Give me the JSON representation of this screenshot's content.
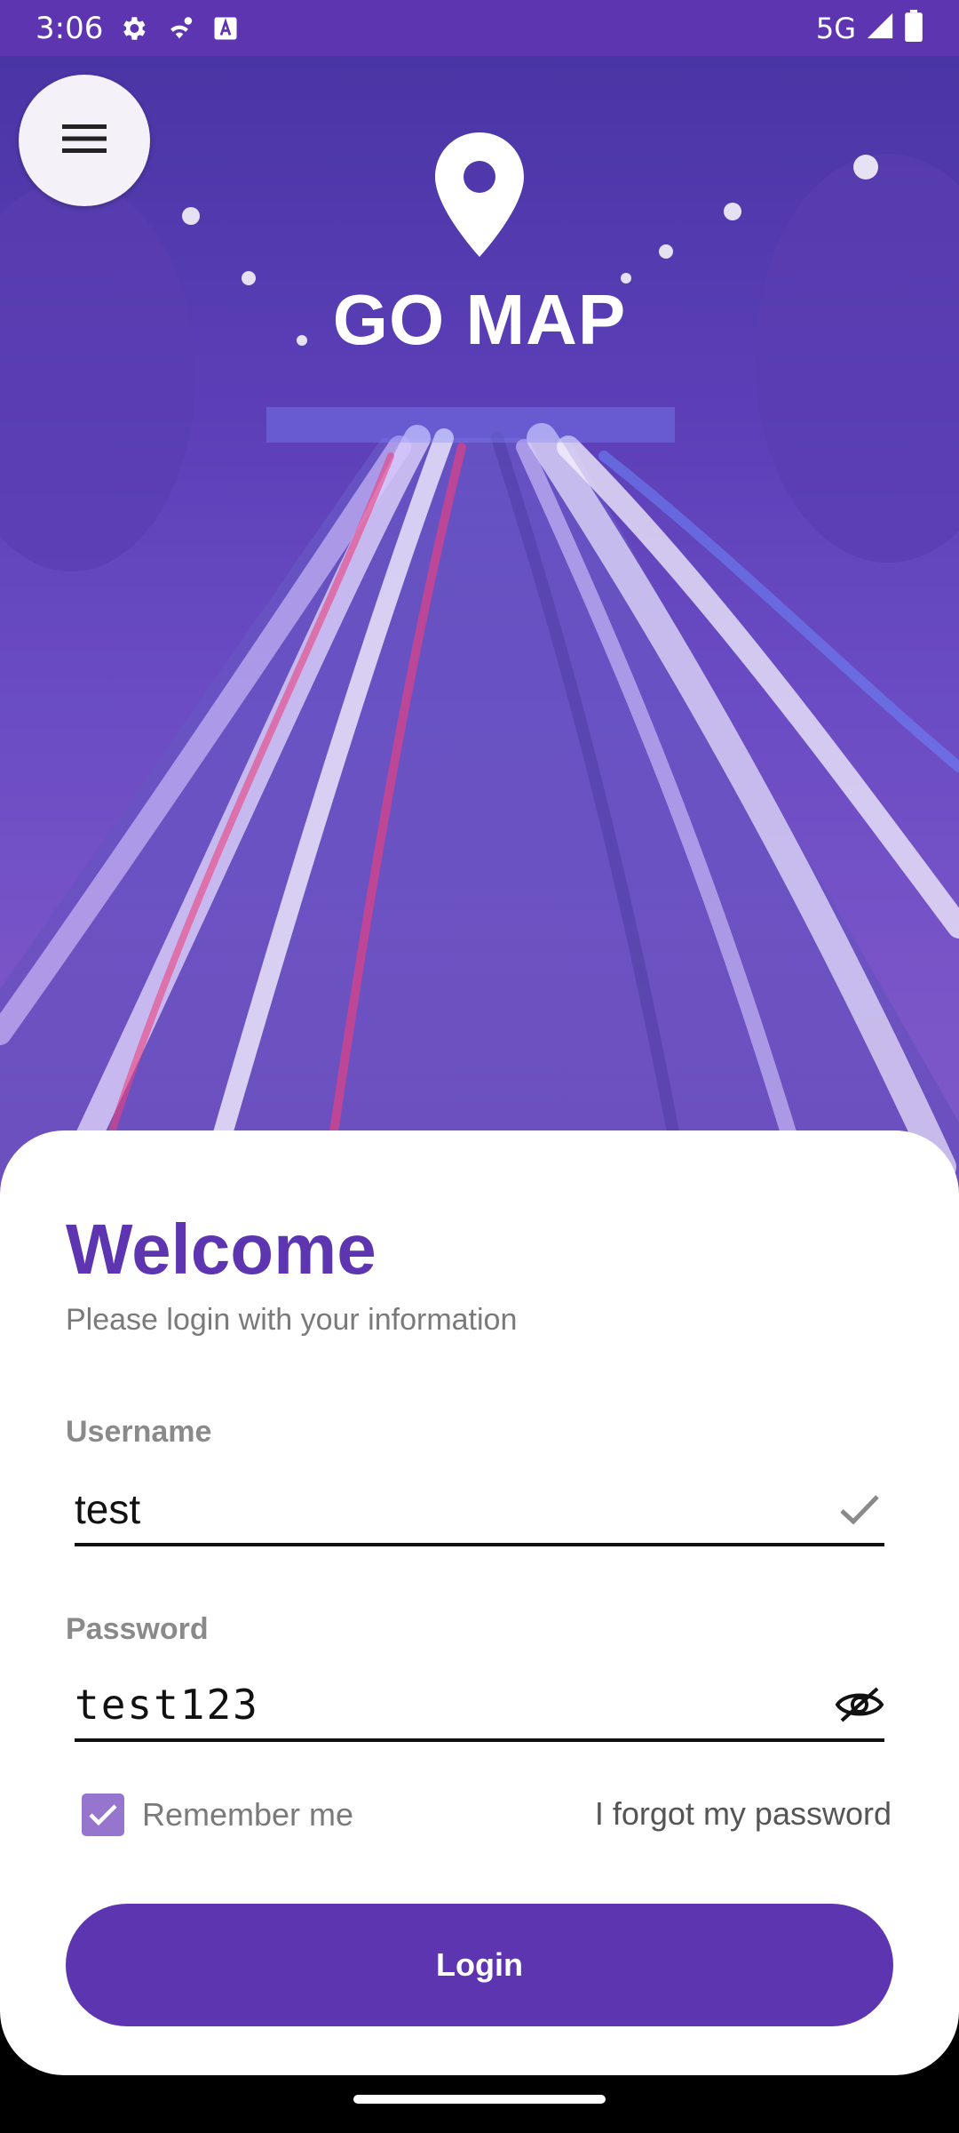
{
  "status_bar": {
    "time": "3:06",
    "network": "5G",
    "icons": [
      "settings-icon",
      "wifi-icon",
      "keyboard-a-icon",
      "signal-icon",
      "battery-icon"
    ]
  },
  "hero": {
    "app_title": "GO MAP",
    "logo_icon": "location-pin-icon",
    "menu_icon": "hamburger-menu-icon"
  },
  "login": {
    "heading": "Welcome",
    "subtitle": "Please login with your information",
    "username_label": "Username",
    "username_value": "test",
    "password_label": "Password",
    "password_value": "test123",
    "remember_me": "Remember me",
    "remember_checked": true,
    "forgot_password": "I forgot my password",
    "login_button": "Login"
  },
  "colors": {
    "primary": "#5e35b1",
    "checkbox": "#9575cd",
    "label_gray": "#8a8a8a"
  }
}
